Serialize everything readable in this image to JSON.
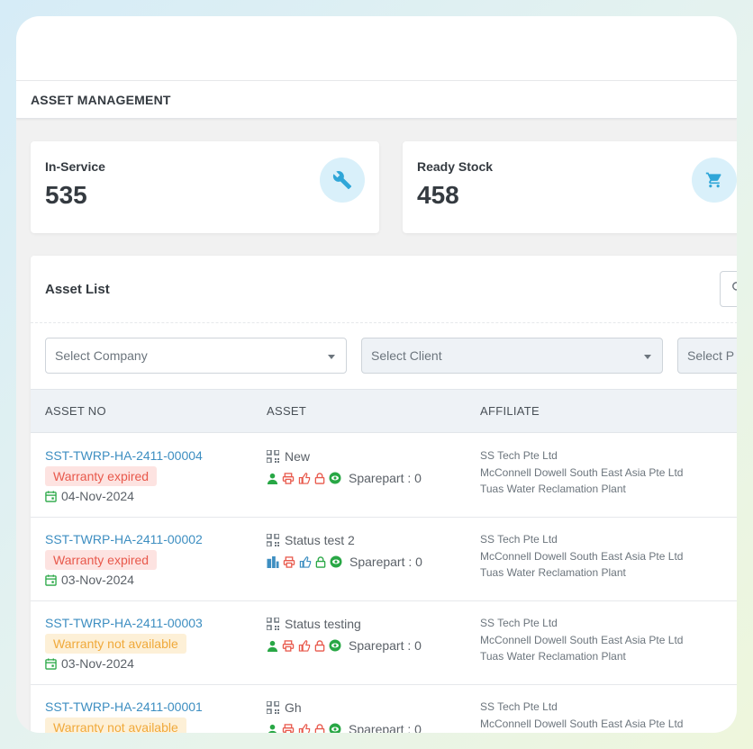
{
  "header": {
    "title": "ASSET MANAGEMENT"
  },
  "stats": [
    {
      "label": "In-Service",
      "value": "535",
      "icon": "wrench-icon"
    },
    {
      "label": "Ready Stock",
      "value": "458",
      "icon": "cart-icon"
    }
  ],
  "list": {
    "title": "Asset List",
    "filters": {
      "company": "Select Company",
      "client": "Select Client",
      "project": "Select P"
    },
    "columns": [
      "ASSET NO",
      "ASSET",
      "AFFILIATE"
    ],
    "sparepart_label": "Sparepart : 0",
    "rows": [
      {
        "asset_no": "SST-TWRP-HA-2411-00004",
        "warranty": "Warranty expired",
        "warranty_status": "expired",
        "date": "04-Nov-2024",
        "asset": "New",
        "first_icon": "person-icon",
        "affiliates": [
          "SS Tech Pte Ltd",
          "McConnell Dowell South East Asia Pte Ltd",
          "Tuas Water Reclamation Plant"
        ]
      },
      {
        "asset_no": "SST-TWRP-HA-2411-00002",
        "warranty": "Warranty expired",
        "warranty_status": "expired",
        "date": "03-Nov-2024",
        "asset": "Status test 2",
        "first_icon": "building-icon",
        "affiliates": [
          "SS Tech Pte Ltd",
          "McConnell Dowell South East Asia Pte Ltd",
          "Tuas Water Reclamation Plant"
        ]
      },
      {
        "asset_no": "SST-TWRP-HA-2411-00003",
        "warranty": "Warranty not available",
        "warranty_status": "not-available",
        "date": "03-Nov-2024",
        "asset": "Status testing",
        "first_icon": "person-icon",
        "affiliates": [
          "SS Tech Pte Ltd",
          "McConnell Dowell South East Asia Pte Ltd",
          "Tuas Water Reclamation Plant"
        ]
      },
      {
        "asset_no": "SST-TWRP-HA-2411-00001",
        "warranty": "Warranty not available",
        "warranty_status": "not-available",
        "date": "",
        "asset": "Gh",
        "first_icon": "person-icon",
        "affiliates": [
          "SS Tech Pte Ltd",
          "McConnell Dowell South East Asia Pte Ltd"
        ]
      }
    ]
  },
  "colors": {
    "link": "#3d8ec1",
    "expired_text": "#e8584b",
    "expired_bg": "#fde3e1",
    "not_available_text": "#f0a93a",
    "not_available_bg": "#fdf0d7",
    "icon_green": "#28a745",
    "icon_red": "#e8584b",
    "icon_blue": "#3d8ec1",
    "stat_icon": "#2fa6d8",
    "stat_icon_bg": "#d9f0fa"
  }
}
